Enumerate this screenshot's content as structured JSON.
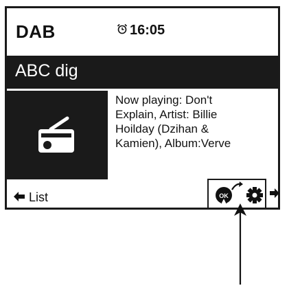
{
  "header": {
    "mode": "DAB",
    "time": "16:05",
    "alarm_icon": "alarm-clock-icon"
  },
  "station": {
    "name": "ABC dig"
  },
  "now_playing": {
    "art_icon": "radio-icon",
    "line1": "Now playing: Don't",
    "line2": "Explain, Artist: Billie",
    "line3": "Hoilday (Dzihan &",
    "line4": "Kamien), Album:Verve"
  },
  "footer": {
    "list_label": "List",
    "left_icon": "arrow-left-icon",
    "right_icon": "arrow-right-icon",
    "ok_icon": "ok-touch-icon",
    "settings_icon": "gear-icon"
  },
  "colors": {
    "ink": "#1a1a1a",
    "background": "#ffffff"
  }
}
